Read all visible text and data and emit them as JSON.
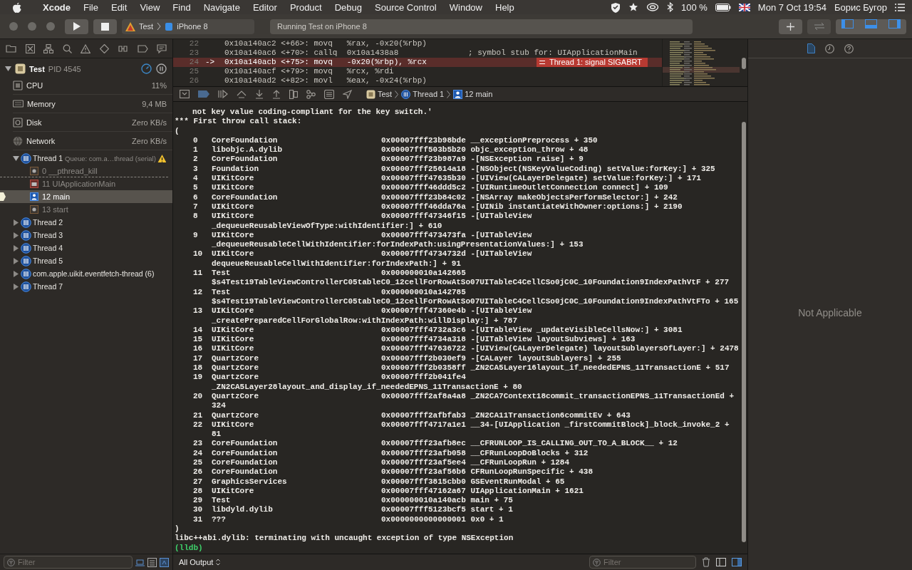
{
  "menubar": {
    "app": "Xcode",
    "menus": [
      "File",
      "Edit",
      "View",
      "Find",
      "Navigate",
      "Editor",
      "Product",
      "Debug",
      "Source Control",
      "Window",
      "Help"
    ],
    "battery": "100 %",
    "clock": "Mon 7 Oct  19:54",
    "user": "Борис Бугор"
  },
  "toolbar": {
    "scheme": "Test",
    "device": "iPhone 8",
    "activity": "Running Test on iPhone 8"
  },
  "navigator": {
    "process": {
      "name": "Test",
      "pid": "PID 4545",
      "expanded": true
    },
    "gauges": [
      {
        "name": "CPU",
        "value": "11%",
        "kind": "cpu"
      },
      {
        "name": "Memory",
        "value": "9,4 MB",
        "kind": "memory"
      },
      {
        "name": "Disk",
        "value": "Zero KB/s",
        "kind": "disk"
      },
      {
        "name": "Network",
        "value": "Zero KB/s",
        "kind": "network"
      }
    ],
    "threads": [
      {
        "name": "Thread 1",
        "queue": "Queue: com.a…thread (serial)",
        "warning": true,
        "expanded": true,
        "children": [
          {
            "label": "0 __pthread_kill",
            "kind": "system",
            "selected": false
          },
          {
            "label": "11 UIApplicationMain",
            "kind": "framework",
            "selected": false
          },
          {
            "label": "12 main",
            "kind": "user",
            "selected": true
          },
          {
            "label": "13 start",
            "kind": "system",
            "selected": false
          }
        ]
      },
      {
        "name": "Thread 2",
        "warning": false,
        "expanded": false
      },
      {
        "name": "Thread 3",
        "warning": false,
        "expanded": false
      },
      {
        "name": "Thread 4",
        "warning": false,
        "expanded": false
      },
      {
        "name": "Thread 5",
        "warning": false,
        "expanded": false
      },
      {
        "name": "com.apple.uikit.eventfetch-thread (6)",
        "warning": false,
        "expanded": false
      },
      {
        "name": "Thread 7",
        "warning": false,
        "expanded": false
      }
    ],
    "filter": {
      "placeholder": "Filter"
    }
  },
  "editor": {
    "lines": [
      {
        "number": "22",
        "code": "0x10a140ac2 <+66>: movq   %rax, -0x20(%rbp)",
        "current": false
      },
      {
        "number": "23",
        "code": "0x10a140ac6 <+70>: callq  0x10a1438a8",
        "comment": "; symbol stub for: UIApplicationMain",
        "current": false
      },
      {
        "number": "24",
        "arrow": "->",
        "code": "0x10a140acb <+75>: movq   -0x20(%rbp), %rcx",
        "current": true,
        "badge": "Thread 1: signal SIGABRT"
      },
      {
        "number": "25",
        "code": "0x10a140acf <+79>: movq   %rcx, %rdi",
        "current": false
      },
      {
        "number": "26",
        "code": "0x10a140ad2 <+82>: movl   %eax, -0x24(%rbp)",
        "current": false
      }
    ]
  },
  "debug_bar": {
    "breadcrumb": [
      {
        "label": "Test",
        "kind": "app"
      },
      {
        "label": "Thread 1",
        "kind": "thread"
      },
      {
        "label": "12 main",
        "kind": "frame"
      }
    ]
  },
  "console": {
    "lines": [
      {
        "kind": "continuation",
        "text": "not key value coding-compliant for the key switch.'"
      },
      {
        "kind": "text",
        "text": "*** First throw call stack:"
      },
      {
        "kind": "text",
        "text": "("
      },
      {
        "kind": "frame",
        "index": "0",
        "library": "CoreFoundation",
        "address": "0x00007fff23b98bde",
        "symbol": "__exceptionPreprocess + 350"
      },
      {
        "kind": "frame",
        "index": "1",
        "library": "libobjc.A.dylib",
        "address": "0x00007fff503b5b20",
        "symbol": "objc_exception_throw + 48"
      },
      {
        "kind": "frame",
        "index": "2",
        "library": "CoreFoundation",
        "address": "0x00007fff23b987a9",
        "symbol": "-[NSException raise] + 9"
      },
      {
        "kind": "frame",
        "index": "3",
        "library": "Foundation",
        "address": "0x00007fff25614a18",
        "symbol": "-[NSObject(NSKeyValueCoding) setValue:forKey:] + 325"
      },
      {
        "kind": "frame",
        "index": "4",
        "library": "UIKitCore",
        "address": "0x00007fff47635b30",
        "symbol": "-[UIView(CALayerDelegate) setValue:forKey:] + 171"
      },
      {
        "kind": "frame",
        "index": "5",
        "library": "UIKitCore",
        "address": "0x00007fff46ddd5c2",
        "symbol": "-[UIRuntimeOutletConnection connect] + 109"
      },
      {
        "kind": "frame",
        "index": "6",
        "library": "CoreFoundation",
        "address": "0x00007fff23b84c02",
        "symbol": "-[NSArray makeObjectsPerformSelector:] + 242"
      },
      {
        "kind": "frame",
        "index": "7",
        "library": "UIKitCore",
        "address": "0x00007fff46dda76a",
        "symbol": "-[UINib instantiateWithOwner:options:] + 2190"
      },
      {
        "kind": "frame",
        "index": "8",
        "library": "UIKitCore",
        "address": "0x00007fff47346f15",
        "symbol": "-[UITableView",
        "symbol_continued": "_dequeueReusableViewOfType:withIdentifier:] + 610"
      },
      {
        "kind": "frame",
        "index": "9",
        "library": "UIKitCore",
        "address": "0x00007fff473473fa",
        "symbol": "-[UITableView",
        "symbol_continued": "_dequeueReusableCellWithIdentifier:forIndexPath:usingPresentationValues:] + 153"
      },
      {
        "kind": "frame",
        "index": "10",
        "library": "UIKitCore",
        "address": "0x00007fff4734732d",
        "symbol": "-[UITableView",
        "symbol_continued": "dequeueReusableCellWithIdentifier:forIndexPath:] + 91"
      },
      {
        "kind": "frame",
        "index": "11",
        "library": "Test",
        "address": "0x000000010a142665",
        "symbol_continued": "$s4Test19TableViewControllerC05tableC0_12cellForRowAtSo07UITableC4CellCSo0jC0C_10Foundation9IndexPathVtF + 277"
      },
      {
        "kind": "frame",
        "index": "12",
        "library": "Test",
        "address": "0x000000010a142785",
        "symbol_continued": "$s4Test19TableViewControllerC05tableC0_12cellForRowAtSo07UITableC4CellCSo0jC0C_10Foundation9IndexPathVtFTo + 165"
      },
      {
        "kind": "frame",
        "index": "13",
        "library": "UIKitCore",
        "address": "0x00007fff47360e4b",
        "symbol": "-[UITableView",
        "symbol_continued": "_createPreparedCellForGlobalRow:withIndexPath:willDisplay:] + 787"
      },
      {
        "kind": "frame",
        "index": "14",
        "library": "UIKitCore",
        "address": "0x00007fff4732a3c6",
        "symbol": "-[UITableView _updateVisibleCellsNow:] + 3081"
      },
      {
        "kind": "frame",
        "index": "15",
        "library": "UIKitCore",
        "address": "0x00007fff4734a318",
        "symbol": "-[UITableView layoutSubviews] + 163"
      },
      {
        "kind": "frame",
        "index": "16",
        "library": "UIKitCore",
        "address": "0x00007fff47636722",
        "symbol": "-[UIView(CALayerDelegate) layoutSublayersOfLayer:] + 2478"
      },
      {
        "kind": "frame",
        "index": "17",
        "library": "QuartzCore",
        "address": "0x00007fff2b030ef9",
        "symbol": "-[CALayer layoutSublayers] + 255"
      },
      {
        "kind": "frame",
        "index": "18",
        "library": "QuartzCore",
        "address": "0x00007fff2b0358ff",
        "symbol": "_ZN2CA5Layer16layout_if_neededEPNS_11TransactionE + 517"
      },
      {
        "kind": "frame",
        "index": "19",
        "library": "QuartzCore",
        "address": "0x00007fff2b041fe4",
        "symbol_continued": "_ZN2CA5Layer28layout_and_display_if_neededEPNS_11TransactionE + 80"
      },
      {
        "kind": "frame",
        "index": "20",
        "library": "QuartzCore",
        "address": "0x00007fff2af8a4a8",
        "symbol": "_ZN2CA7Context18commit_transactionEPNS_11TransactionEd +",
        "symbol_continued": "324"
      },
      {
        "kind": "frame",
        "index": "21",
        "library": "QuartzCore",
        "address": "0x00007fff2afbfab3",
        "symbol": "_ZN2CA11Transaction6commitEv + 643"
      },
      {
        "kind": "frame",
        "index": "22",
        "library": "UIKitCore",
        "address": "0x00007fff4717a1e1",
        "symbol": "__34-[UIApplication _firstCommitBlock]_block_invoke_2 +",
        "symbol_continued": "81"
      },
      {
        "kind": "frame",
        "index": "23",
        "library": "CoreFoundation",
        "address": "0x00007fff23afb8ec",
        "symbol": "__CFRUNLOOP_IS_CALLING_OUT_TO_A_BLOCK__ + 12"
      },
      {
        "kind": "frame",
        "index": "24",
        "library": "CoreFoundation",
        "address": "0x00007fff23afb058",
        "symbol": "__CFRunLoopDoBlocks + 312"
      },
      {
        "kind": "frame",
        "index": "25",
        "library": "CoreFoundation",
        "address": "0x00007fff23af5ee4",
        "symbol": "__CFRunLoopRun + 1284"
      },
      {
        "kind": "frame",
        "index": "26",
        "library": "CoreFoundation",
        "address": "0x00007fff23af56b6",
        "symbol": "CFRunLoopRunSpecific + 438"
      },
      {
        "kind": "frame",
        "index": "27",
        "library": "GraphicsServices",
        "address": "0x00007fff3815cbb0",
        "symbol": "GSEventRunModal + 65"
      },
      {
        "kind": "frame",
        "index": "28",
        "library": "UIKitCore",
        "address": "0x00007fff47162a67",
        "symbol": "UIApplicationMain + 1621"
      },
      {
        "kind": "frame",
        "index": "29",
        "library": "Test",
        "address": "0x000000010a140acb",
        "symbol": "main + 75"
      },
      {
        "kind": "frame",
        "index": "30",
        "library": "libdyld.dylib",
        "address": "0x00007fff5123bcf5",
        "symbol": "start + 1"
      },
      {
        "kind": "frame",
        "index": "31",
        "library": "???",
        "address": "0x0000000000000001",
        "symbol": "0x0 + 1"
      },
      {
        "kind": "text",
        "text": ")"
      },
      {
        "kind": "text",
        "text": "libc++abi.dylib: terminating with uncaught exception of type NSException"
      },
      {
        "kind": "prompt",
        "text": "(lldb)"
      }
    ],
    "output_filter": "All Output",
    "filter": {
      "placeholder": "Filter"
    }
  },
  "inspector": {
    "message": "Not Applicable"
  }
}
